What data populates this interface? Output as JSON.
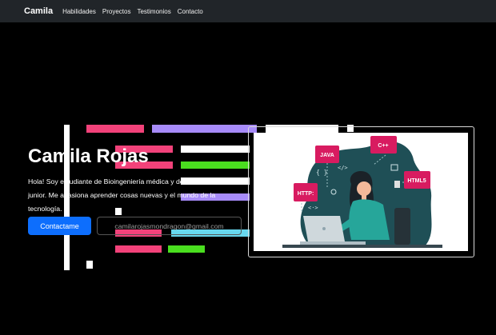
{
  "nav": {
    "brand": "Camila",
    "links": [
      "Habilidades",
      "Proyectos",
      "Testimonios",
      "Contacto"
    ]
  },
  "hero": {
    "title": "Camila Rojas",
    "description": "Hola! Soy estudiante de Bioingeniería médica y desarrolladora junior. Me apasiona aprender cosas nuevas y el mundo de la tecnología.",
    "contact_button": "Contactame",
    "email": "camilarojasmondragon@gmail.com"
  },
  "illustration": {
    "tags": [
      "JAVA",
      "C++",
      "HTTP:",
      "HTML5"
    ]
  },
  "colors": {
    "primary": "#0d6efd",
    "navbar": "#212529",
    "pink": "#f2427a",
    "purple": "#a78bfa",
    "green": "#4ade1f",
    "teal": "#1f4f56",
    "tag": "#d81b60"
  }
}
